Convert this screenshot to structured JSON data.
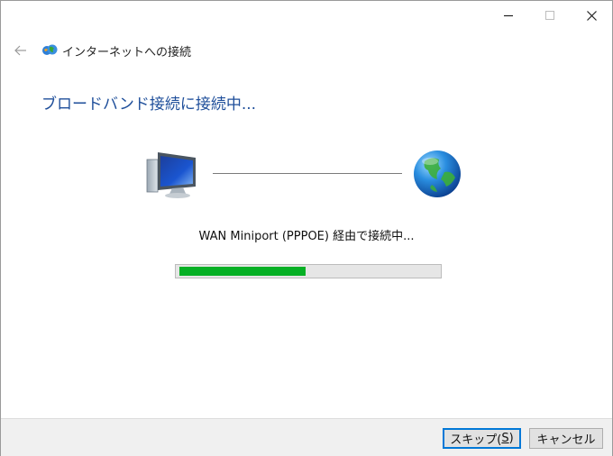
{
  "window": {
    "minimize_icon": "minimize-icon",
    "maximize_icon": "maximize-icon",
    "close_icon": "close-icon"
  },
  "nav": {
    "back_icon": "back-arrow-icon",
    "icon": "network-connection-icon",
    "title": "インターネットへの接続"
  },
  "main": {
    "heading": "ブロードバンド接続に接続中...",
    "status": "WAN Miniport (PPPOE) 経由で接続中...",
    "progress": 0.49,
    "progress_color": "#06b025",
    "heading_color": "#1e4e9a"
  },
  "footer": {
    "skip_label": "スキップ(",
    "skip_mnemonic": "S",
    "skip_suffix": ")",
    "cancel_label": "キャンセル"
  }
}
